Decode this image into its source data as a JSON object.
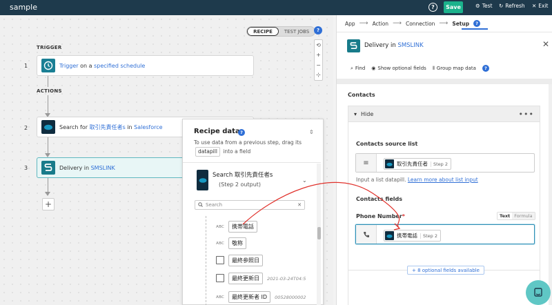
{
  "topbar": {
    "app_title": "sample",
    "help": "?",
    "save_label": "Save",
    "test_label": "Test",
    "refresh_label": "Refresh",
    "exit_label": "Exit"
  },
  "canvas": {
    "toggle": {
      "recipe": "RECIPE",
      "test_jobs": "TEST JOBS"
    },
    "trigger_label": "TRIGGER",
    "actions_label": "ACTIONS",
    "steps": [
      {
        "num": "1",
        "pre": "Trigger",
        "mid": " on a ",
        "post": "specified schedule"
      },
      {
        "num": "2",
        "pre": "Search for ",
        "mid": "取引先責任者s",
        "mid2": " in ",
        "post": "Salesforce"
      },
      {
        "num": "3",
        "pre": "Delivery in ",
        "post": "SMSLINK"
      }
    ]
  },
  "recipe_data": {
    "title": "Recipe data",
    "desc_pre": "To use data from a previous step, drag its",
    "desc_code": "datapill",
    "desc_post": "into a field",
    "step_title_pre": "Search ",
    "step_title_name": "取引先責任者s",
    "step_sub": "(Step 2 output)",
    "search_placeholder": "Search",
    "pills": [
      {
        "type": "ABC",
        "label": "携帯電話",
        "sample": ""
      },
      {
        "type": "ABC",
        "label": "敬称",
        "sample": ""
      },
      {
        "type": "cal",
        "label": "最終参照日",
        "sample": ""
      },
      {
        "type": "cal",
        "label": "最終更新日",
        "sample": "2021-03-24T04:5"
      },
      {
        "type": "ABC",
        "label": "最終更新者 ID",
        "sample": "00528000002"
      }
    ]
  },
  "right_panel": {
    "tabs": [
      "App",
      "Action",
      "Connection",
      "Setup"
    ],
    "active_tab": "Setup",
    "title_pre": "Delivery in ",
    "title_link": "SMSLINK",
    "tools": [
      "Find",
      "Show optional fields",
      "Group map data"
    ],
    "section_contacts": "Contacts",
    "hide_label": "Hide",
    "source_list_label": "Contacts source list",
    "source_pill_label": "取引先責任者",
    "source_pill_step": "Step 2",
    "source_hint": "Input a list datapill.",
    "source_hint_link": "Learn more about list input",
    "fields_label": "Contacts fields",
    "phone_label": "Phone Number",
    "phone_req": "*",
    "mode_text": "Text",
    "mode_formula": "Formula",
    "phone_pill_label": "携帯電話",
    "phone_pill_step": "Step 2",
    "optional_fields": "+ 8 optional fields available"
  },
  "colors": {
    "topbar": "#1e3a4c",
    "accent": "#1bb28c",
    "link": "#2f6fd6",
    "arrow": "#e0302a"
  }
}
